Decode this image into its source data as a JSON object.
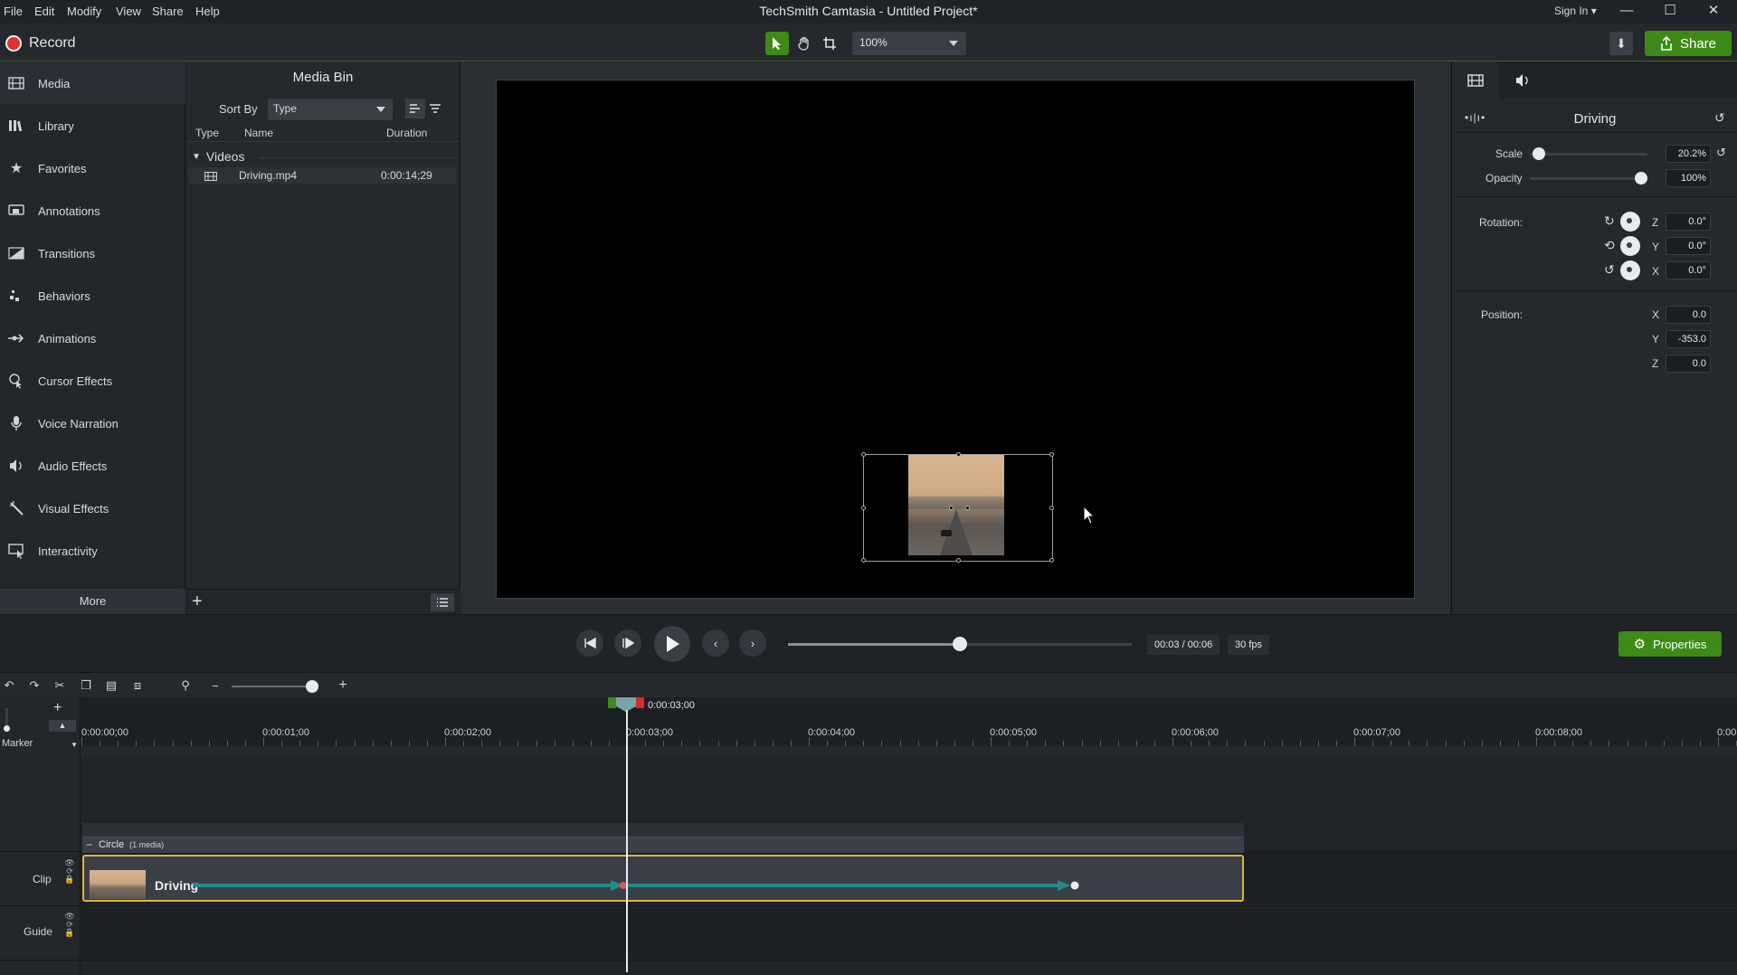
{
  "menu": {
    "items": [
      "File",
      "Edit",
      "Modify",
      "View",
      "Share",
      "Help"
    ],
    "app_title": "TechSmith Camtasia - Untitled Project*",
    "sign_in": "Sign In"
  },
  "toolbar": {
    "record_label": "Record",
    "zoom_value": "100%",
    "share_label": "Share",
    "accent_green": "#3d8a17",
    "record_red": "#e0322d"
  },
  "sidebar": {
    "items": [
      {
        "label": "Media",
        "icon": "film-icon"
      },
      {
        "label": "Library",
        "icon": "library-icon"
      },
      {
        "label": "Favorites",
        "icon": "star-icon"
      },
      {
        "label": "Annotations",
        "icon": "annotation-icon"
      },
      {
        "label": "Transitions",
        "icon": "transition-icon"
      },
      {
        "label": "Behaviors",
        "icon": "behavior-icon"
      },
      {
        "label": "Animations",
        "icon": "animation-icon"
      },
      {
        "label": "Cursor Effects",
        "icon": "cursor-icon"
      },
      {
        "label": "Voice Narration",
        "icon": "microphone-icon"
      },
      {
        "label": "Audio Effects",
        "icon": "speaker-icon"
      },
      {
        "label": "Visual Effects",
        "icon": "wand-icon"
      },
      {
        "label": "Interactivity",
        "icon": "interactivity-icon"
      }
    ],
    "more_label": "More"
  },
  "media_bin": {
    "title": "Media Bin",
    "sort_by_label": "Sort By",
    "sort_value": "Type",
    "columns": [
      "Type",
      "Name",
      "Duration"
    ],
    "group_label": "Videos",
    "files": [
      {
        "name": "Driving.mp4",
        "duration": "0:00:14;29"
      }
    ]
  },
  "properties": {
    "title": "Driving",
    "scale_label": "Scale",
    "scale_value": "20.2%",
    "scale_level": 0.03,
    "opacity_label": "Opacity",
    "opacity_value": "100%",
    "opacity_level": 1.0,
    "rotation_label": "Rotation:",
    "rotation": [
      {
        "axis": "Z",
        "value": "0.0°"
      },
      {
        "axis": "Y",
        "value": "0.0°"
      },
      {
        "axis": "X",
        "value": "0.0°"
      }
    ],
    "position_label": "Position:",
    "position": [
      {
        "axis": "X",
        "value": "0.0"
      },
      {
        "axis": "Y",
        "value": "-353.0"
      },
      {
        "axis": "Z",
        "value": "0.0"
      }
    ]
  },
  "playback": {
    "timecode": "00:03 / 00:06",
    "fps": "30 fps",
    "progress": 0.5,
    "properties_label": "Properties"
  },
  "timeline": {
    "playhead_time": "0:00:03;00",
    "ruler_labels": [
      "0:00:00;00",
      "0:00:01;00",
      "0:00:02;00",
      "0:00:03;00",
      "0:00:04;00",
      "0:00:05;00",
      "0:00:06;00",
      "0:00:07;00",
      "0:00:08;00",
      "0:00"
    ],
    "marker_label": "Marker",
    "tracks": [
      "Clip",
      "Guide"
    ],
    "group_name": "Circle",
    "group_count": "(1 media)",
    "clip_name": "Driving",
    "clip_border": "#e0b43c",
    "animation_color": "#1f8f86"
  }
}
